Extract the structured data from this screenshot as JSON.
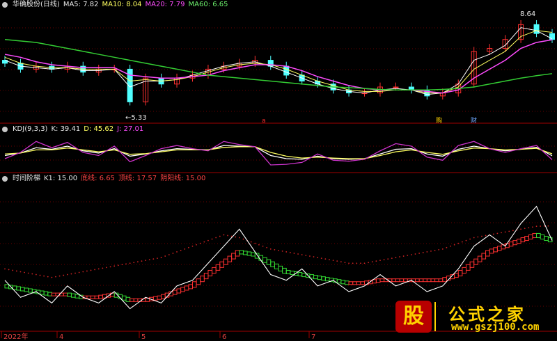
{
  "colors": {
    "ma5": "#ffffff",
    "ma10": "#ffff60",
    "ma20": "#ff4cff",
    "ma60": "#33cc33",
    "up": "#ff3030",
    "down": "#50ffff",
    "grid": "#6a0000",
    "sep": "#a00000"
  },
  "header_price": {
    "title": "华确股份(日线)",
    "ma5": "MA5: 7.82",
    "ma10": "MA10: 8.04",
    "ma20": "MA20: 7.79",
    "ma60": "MA60: 6.65"
  },
  "header_kdj": {
    "title": "KDJ(9,3,3)",
    "k": "K: 39.41",
    "d": "D: 45.62",
    "j": "J: 27.01"
  },
  "header_step": {
    "title": "时间阶梯",
    "k1": "K1: 15.00",
    "bottom": "底线: 6.65",
    "top": "顶线: 17.57",
    "yinyang": "阴阳线: 15.00"
  },
  "annotations": {
    "high": "8.64",
    "low": "5.33",
    "mark_a": "a",
    "mark_buy": "购",
    "mark_cai": "财"
  },
  "xaxis": {
    "year": "2022年",
    "m4": "4",
    "m5": "5",
    "m6": "6",
    "m7": "7"
  },
  "watermark": {
    "logo": "股",
    "name": "公式之家",
    "url": "www.gszj100.com"
  },
  "chart_data": [
    {
      "type": "candlestick",
      "title": "华确股份(日线)",
      "x": [
        0,
        5,
        10,
        15,
        20,
        25,
        30,
        35,
        40,
        45,
        50,
        55,
        60,
        65,
        70,
        75,
        80,
        85,
        90,
        95,
        100,
        105,
        110,
        115,
        120,
        125,
        130,
        135,
        140,
        145,
        150,
        155,
        160,
        165,
        170,
        175
      ],
      "close": [
        7.0,
        6.8,
        6.9,
        6.8,
        6.9,
        6.7,
        6.8,
        6.8,
        5.7,
        6.5,
        6.3,
        6.5,
        6.6,
        6.8,
        6.9,
        7.0,
        7.1,
        6.9,
        6.6,
        6.4,
        6.3,
        6.1,
        6.0,
        6.0,
        6.2,
        6.2,
        6.1,
        5.9,
        6.0,
        6.3,
        7.4,
        7.5,
        7.8,
        8.3,
        8.0,
        7.8
      ],
      "high": 8.64,
      "low": 5.33,
      "ylim": [
        5.1,
        8.8
      ],
      "series": [
        {
          "name": "MA5",
          "values": [
            7.1,
            6.9,
            6.85,
            6.8,
            6.85,
            6.75,
            6.75,
            6.8,
            6.2,
            6.4,
            6.4,
            6.45,
            6.6,
            6.75,
            6.9,
            7.0,
            7.05,
            6.9,
            6.7,
            6.5,
            6.3,
            6.15,
            6.05,
            6.0,
            6.1,
            6.15,
            6.1,
            5.95,
            6.0,
            6.3,
            7.1,
            7.3,
            7.6,
            8.2,
            8.1,
            7.82
          ]
        },
        {
          "name": "MA10",
          "values": [
            7.2,
            7.0,
            6.9,
            6.85,
            6.85,
            6.8,
            6.8,
            6.8,
            6.4,
            6.45,
            6.4,
            6.45,
            6.55,
            6.7,
            6.85,
            6.95,
            7.0,
            6.95,
            6.8,
            6.6,
            6.4,
            6.25,
            6.1,
            6.05,
            6.05,
            6.1,
            6.1,
            6.0,
            6.0,
            6.2,
            6.8,
            7.1,
            7.4,
            7.9,
            8.1,
            8.04
          ]
        },
        {
          "name": "MA20",
          "values": [
            7.3,
            7.2,
            7.05,
            6.95,
            6.9,
            6.85,
            6.85,
            6.85,
            6.6,
            6.55,
            6.5,
            6.5,
            6.55,
            6.6,
            6.75,
            6.85,
            6.95,
            6.95,
            6.9,
            6.75,
            6.55,
            6.4,
            6.25,
            6.15,
            6.1,
            6.1,
            6.1,
            6.05,
            6.0,
            6.1,
            6.5,
            6.8,
            7.1,
            7.5,
            7.7,
            7.79
          ]
        },
        {
          "name": "MA60",
          "values": [
            7.8,
            7.75,
            7.7,
            7.6,
            7.5,
            7.4,
            7.3,
            7.2,
            7.1,
            7.0,
            6.9,
            6.8,
            6.7,
            6.6,
            6.55,
            6.5,
            6.45,
            6.4,
            6.35,
            6.3,
            6.25,
            6.2,
            6.18,
            6.15,
            6.12,
            6.1,
            6.1,
            6.1,
            6.12,
            6.15,
            6.2,
            6.3,
            6.4,
            6.5,
            6.58,
            6.65
          ]
        }
      ]
    },
    {
      "type": "line",
      "title": "KDJ(9,3,3)",
      "ylim": [
        -10,
        110
      ],
      "x": [
        0,
        5,
        10,
        15,
        20,
        25,
        30,
        35,
        40,
        45,
        50,
        55,
        60,
        65,
        70,
        75,
        80,
        85,
        90,
        95,
        100,
        105,
        110,
        115,
        120,
        125,
        130,
        135,
        140,
        145,
        150,
        155,
        160,
        165,
        170,
        175
      ],
      "series": [
        {
          "name": "K",
          "values": [
            40,
            48,
            65,
            60,
            70,
            55,
            48,
            62,
            38,
            45,
            55,
            62,
            60,
            58,
            72,
            70,
            68,
            40,
            30,
            28,
            38,
            30,
            28,
            30,
            45,
            60,
            62,
            45,
            38,
            60,
            70,
            62,
            55,
            60,
            66,
            39.41
          ]
        },
        {
          "name": "D",
          "values": [
            45,
            48,
            58,
            58,
            64,
            58,
            52,
            58,
            44,
            46,
            52,
            58,
            58,
            58,
            66,
            68,
            68,
            50,
            38,
            32,
            35,
            32,
            30,
            30,
            40,
            52,
            58,
            50,
            44,
            55,
            64,
            62,
            58,
            60,
            63,
            45.62
          ]
        },
        {
          "name": "J",
          "values": [
            30,
            50,
            85,
            65,
            82,
            50,
            40,
            70,
            20,
            40,
            62,
            72,
            62,
            55,
            85,
            75,
            68,
            10,
            12,
            18,
            45,
            25,
            22,
            28,
            55,
            78,
            70,
            35,
            25,
            72,
            85,
            62,
            50,
            62,
            72,
            27.01
          ]
        }
      ]
    },
    {
      "type": "line",
      "title": "时间阶梯",
      "ylim": [
        0,
        25
      ],
      "x": [
        0,
        5,
        10,
        15,
        20,
        25,
        30,
        35,
        40,
        45,
        50,
        55,
        60,
        65,
        70,
        75,
        80,
        85,
        90,
        95,
        100,
        105,
        110,
        115,
        120,
        125,
        130,
        135,
        140,
        145,
        150,
        155,
        160,
        165,
        170,
        175
      ],
      "series": [
        {
          "name": "K1",
          "values": [
            8,
            5,
            6,
            4,
            7,
            5,
            4,
            6,
            3,
            5,
            4,
            7,
            8,
            11,
            14,
            17,
            13,
            9,
            8,
            10,
            7,
            8,
            6,
            7,
            9,
            7,
            8,
            6,
            7,
            10,
            14,
            16,
            14,
            18,
            21,
            15.0
          ]
        },
        {
          "name": "底线",
          "values": [
            6.65,
            6.65,
            6.6,
            6.6,
            6.6,
            6.6,
            6.6,
            6.6,
            6.6,
            6.6,
            6.6,
            6.6,
            6.6,
            6.6,
            6.6,
            6.6,
            6.6,
            6.6,
            6.6,
            6.6,
            6.6,
            6.6,
            6.6,
            6.6,
            6.6,
            6.6,
            6.6,
            6.6,
            6.6,
            6.6,
            6.6,
            6.6,
            6.6,
            6.6,
            6.65,
            6.65
          ]
        },
        {
          "name": "顶线",
          "values": [
            10,
            9.5,
            9,
            8.5,
            9,
            9.5,
            10,
            10.5,
            11,
            11.5,
            12,
            13,
            14,
            15,
            16,
            15.5,
            14.5,
            13.5,
            13,
            12.5,
            12,
            11.5,
            11,
            11,
            11.5,
            12,
            12.5,
            13,
            13.5,
            14.5,
            15.5,
            16,
            16.5,
            17,
            17.5,
            17.57
          ]
        },
        {
          "name": "阴阳线",
          "values": [
            7,
            6.5,
            6,
            5.5,
            5.5,
            5,
            5,
            5.5,
            4.5,
            4.5,
            5,
            6,
            7,
            9,
            11,
            13,
            12.5,
            11,
            9.5,
            9,
            8.5,
            8,
            7.5,
            7.5,
            8,
            8,
            8,
            8,
            8,
            9,
            11,
            13,
            14,
            15,
            16,
            15.0
          ]
        }
      ]
    }
  ]
}
